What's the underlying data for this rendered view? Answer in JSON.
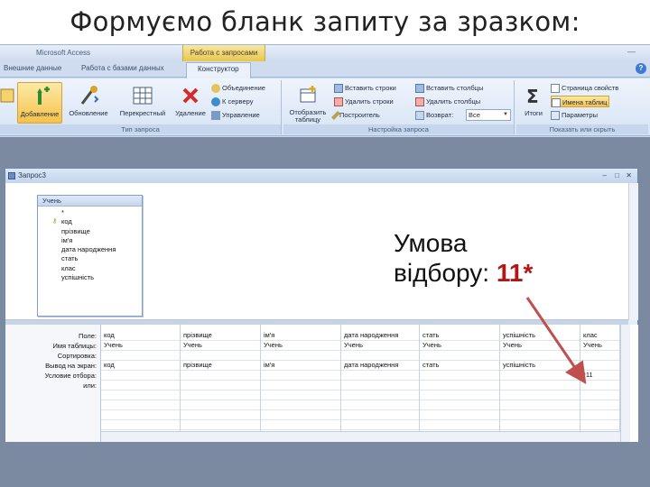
{
  "slide_title": "Формуємо бланк запиту за зразком:",
  "app": {
    "title": "Microsoft Access",
    "context_tab": "Работа с запросами"
  },
  "tabs": [
    "Внешние данные",
    "Работа с базами данных",
    "Конструктор"
  ],
  "ribbon": {
    "group_query_type": {
      "label": "Тип запроса",
      "buttons": {
        "dobavlenie": "Добавление",
        "obnovlenie": "Обновление",
        "perekrestny": "Перекрестный",
        "udalenie": "Удаление",
        "union": "Объединение",
        "server": "К серверу",
        "control": "Управление"
      }
    },
    "group_setup": {
      "label": "Настройка запроса",
      "show_table": "Отобразить таблицу",
      "insert_rows": "Вставить строки",
      "delete_rows": "Удалить строки",
      "builder": "Построитель",
      "insert_cols": "Вставить столбцы",
      "delete_cols": "Удалить столбцы",
      "return": "Возврат:",
      "return_value": "Все"
    },
    "group_show": {
      "label": "Показать или скрыть",
      "totals": "Итоги",
      "props": "Страница свойств",
      "table_names": "Имена таблиц",
      "params": "Параметры"
    }
  },
  "query_window": {
    "title": "Запрос3",
    "table": {
      "name": "Учень",
      "fields": [
        "*",
        "код",
        "прізвище",
        "ім'я",
        "дата народження",
        "стать",
        "клас",
        "успішність"
      ]
    },
    "row_labels": [
      "Поле:",
      "Имя таблицы:",
      "Сортировка:",
      "Вывод на экран:",
      "Условие отбора:",
      "или:"
    ],
    "columns": [
      {
        "field": "код",
        "table": "Учень",
        "show": "код",
        "criteria": ""
      },
      {
        "field": "прізвище",
        "table": "Учень",
        "show": "прізвище",
        "criteria": ""
      },
      {
        "field": "ім'я",
        "table": "Учень",
        "show": "ім'я",
        "criteria": ""
      },
      {
        "field": "дата народження",
        "table": "Учень",
        "show": "дата народження",
        "criteria": ""
      },
      {
        "field": "стать",
        "table": "Учень",
        "show": "стать",
        "criteria": ""
      },
      {
        "field": "успішність",
        "table": "Учень",
        "show": "успішність",
        "criteria": ""
      },
      {
        "field": "клас",
        "table": "Учень",
        "show": "",
        "criteria": "*11"
      }
    ]
  },
  "callout": {
    "line1": "Умова",
    "line2": "відбору: ",
    "value": "11*"
  }
}
